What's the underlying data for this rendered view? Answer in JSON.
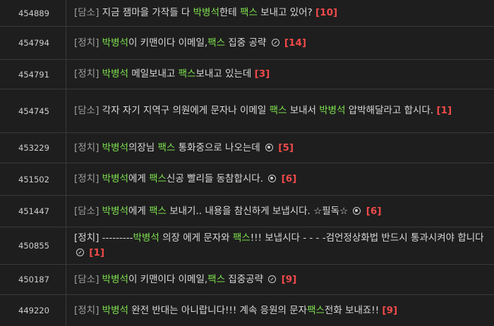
{
  "rows": [
    {
      "num": "454889",
      "segments": [
        {
          "t": "[담소]",
          "s": "cat"
        },
        {
          "t": " 지금 잼마을 가작들 다 ",
          "s": ""
        },
        {
          "t": "박병석",
          "s": "hl"
        },
        {
          "t": "한테 ",
          "s": ""
        },
        {
          "t": "팩스",
          "s": "hl"
        },
        {
          "t": " 보내고 있어? ",
          "s": ""
        },
        {
          "t": "[10]",
          "s": "cnt"
        }
      ]
    },
    {
      "num": "454794",
      "segments": [
        {
          "t": "[정치]",
          "s": "cat"
        },
        {
          "t": " ",
          "s": ""
        },
        {
          "t": "박병석",
          "s": "hl"
        },
        {
          "t": "이 키맨이다 이메일,",
          "s": ""
        },
        {
          "t": "팩스",
          "s": "hl"
        },
        {
          "t": " 집중 공략 ",
          "s": ""
        },
        {
          "icon": "link-icon"
        },
        {
          "t": " ",
          "s": ""
        },
        {
          "t": "[14]",
          "s": "cnt"
        }
      ]
    },
    {
      "num": "454791",
      "segments": [
        {
          "t": "[정치]",
          "s": "cat"
        },
        {
          "t": " ",
          "s": ""
        },
        {
          "t": "박병석",
          "s": "hl"
        },
        {
          "t": " 메일보내고 ",
          "s": ""
        },
        {
          "t": "팩스",
          "s": "hl"
        },
        {
          "t": "보내고 있는데 ",
          "s": ""
        },
        {
          "t": "[3]",
          "s": "cnt"
        }
      ]
    },
    {
      "num": "454745",
      "segments": [
        {
          "t": "[담소]",
          "s": "cat"
        },
        {
          "t": " 각자 자기 지역구 의원에게 문자나 이메일 ",
          "s": ""
        },
        {
          "t": "팩스",
          "s": "hl"
        },
        {
          "t": " 보내서 ",
          "s": ""
        },
        {
          "t": "박병석",
          "s": "hl"
        },
        {
          "t": " 압박해달라고 합시다. ",
          "s": ""
        },
        {
          "t": "[1]",
          "s": "cnt"
        }
      ]
    },
    {
      "num": "453229",
      "segments": [
        {
          "t": "[정치]",
          "s": "cat"
        },
        {
          "t": " ",
          "s": ""
        },
        {
          "t": "박병석",
          "s": "hl"
        },
        {
          "t": "의장님 ",
          "s": ""
        },
        {
          "t": "팩스",
          "s": "hl"
        },
        {
          "t": " 통화중으로 나오는데 ",
          "s": ""
        },
        {
          "icon": "photo-icon"
        },
        {
          "t": " ",
          "s": ""
        },
        {
          "t": "[5]",
          "s": "cnt"
        }
      ]
    },
    {
      "num": "451502",
      "segments": [
        {
          "t": "[정치]",
          "s": "cat"
        },
        {
          "t": " ",
          "s": ""
        },
        {
          "t": "박병석",
          "s": "hl"
        },
        {
          "t": "에게 ",
          "s": ""
        },
        {
          "t": "팩스",
          "s": "hl"
        },
        {
          "t": "신공 빨리들 동참합시다. ",
          "s": ""
        },
        {
          "icon": "photo-icon"
        },
        {
          "t": " ",
          "s": ""
        },
        {
          "t": "[6]",
          "s": "cnt"
        }
      ]
    },
    {
      "num": "451447",
      "segments": [
        {
          "t": "[담소]",
          "s": "cat"
        },
        {
          "t": " ",
          "s": ""
        },
        {
          "t": "박병석",
          "s": "hl"
        },
        {
          "t": "에게 ",
          "s": ""
        },
        {
          "t": "팩스",
          "s": "hl"
        },
        {
          "t": " 보내기.. 내용을 참신하게 보냅시다. ☆필독☆ ",
          "s": ""
        },
        {
          "icon": "photo-icon"
        },
        {
          "t": " ",
          "s": ""
        },
        {
          "t": "[6]",
          "s": "cnt"
        }
      ]
    },
    {
      "num": "450855",
      "segments": [
        {
          "t": "[정치]",
          "s": ""
        },
        {
          "t": " ---------",
          "s": ""
        },
        {
          "t": "박병석",
          "s": "hl"
        },
        {
          "t": " 의장 에게 문자와 ",
          "s": ""
        },
        {
          "t": "팩스",
          "s": "hl"
        },
        {
          "t": "!!! 보냅시다 - - - -검언정상화법 반드시 통과시켜야 합니다 ",
          "s": ""
        },
        {
          "icon": "link-icon"
        },
        {
          "t": " ",
          "s": ""
        },
        {
          "t": "[1]",
          "s": "cnt"
        }
      ]
    },
    {
      "num": "450187",
      "segments": [
        {
          "t": "[담소]",
          "s": "cat"
        },
        {
          "t": " ",
          "s": ""
        },
        {
          "t": "박병석",
          "s": "hl"
        },
        {
          "t": "이 키맨이다 이메일,",
          "s": ""
        },
        {
          "t": "팩스",
          "s": "hl"
        },
        {
          "t": " 집중공략 ",
          "s": ""
        },
        {
          "icon": "link-icon"
        },
        {
          "t": " ",
          "s": ""
        },
        {
          "t": "[9]",
          "s": "cnt"
        }
      ]
    },
    {
      "num": "449220",
      "segments": [
        {
          "t": "[정치]",
          "s": "cat"
        },
        {
          "t": " ",
          "s": ""
        },
        {
          "t": "박병석",
          "s": "hl"
        },
        {
          "t": " 완전 반대는 아니랍니다!!! 계속 응원의 문자",
          "s": ""
        },
        {
          "t": "팩스",
          "s": "hl"
        },
        {
          "t": "전화 보내죠!! ",
          "s": ""
        },
        {
          "t": "[9]",
          "s": "cnt"
        }
      ]
    }
  ]
}
